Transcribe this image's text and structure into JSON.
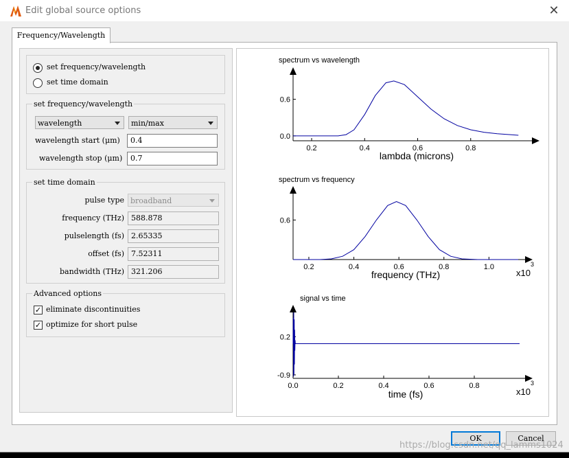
{
  "window": {
    "title": "Edit global source options",
    "close_glyph": "✕",
    "app_icon": "lumerical-logo-icon"
  },
  "tabs": [
    {
      "label": "Frequency/Wavelength",
      "active": true
    }
  ],
  "mode": {
    "options": [
      {
        "label": "set frequency/wavelength",
        "selected": true
      },
      {
        "label": "set time domain",
        "selected": false
      }
    ]
  },
  "freq_wl": {
    "title": "set frequency/wavelength",
    "type_select": "wavelength",
    "range_select": "min/max",
    "start_label": "wavelength start (μm)",
    "start_value": "0.4",
    "stop_label": "wavelength stop (μm)",
    "stop_value": "0.7"
  },
  "time_domain": {
    "title": "set time domain",
    "pulse_type_label": "pulse type",
    "pulse_type_value": "broadband",
    "frequency_label": "frequency (THz)",
    "frequency_value": "588.878",
    "pulselength_label": "pulselength (fs)",
    "pulselength_value": "2.65335",
    "offset_label": "offset (fs)",
    "offset_value": "7.52311",
    "bandwidth_label": "bandwidth (THz)",
    "bandwidth_value": "321.206"
  },
  "advanced": {
    "title": "Advanced options",
    "options": [
      {
        "label": "eliminate discontinuities",
        "checked": true
      },
      {
        "label": "optimize for short pulse",
        "checked": true
      }
    ]
  },
  "buttons": {
    "ok": "OK",
    "cancel": "Cancel"
  },
  "watermark": "https://blog.csdn.net/qq_lamms1024",
  "colors": {
    "curve": "#0000a0",
    "accent": "#0078d7"
  },
  "chart_data": [
    {
      "type": "line",
      "title": "spectrum vs wavelength",
      "xlabel": "lambda (microns)",
      "ylabel": "",
      "x_ticks": [
        "0.2",
        "0.4",
        "0.6",
        "0.8"
      ],
      "y_ticks": [
        "0.0",
        "0.6"
      ],
      "xlim": [
        0.13,
        1.0
      ],
      "ylim": [
        -0.08,
        1.0
      ],
      "series": [
        {
          "x": [
            0.13,
            0.3,
            0.33,
            0.36,
            0.4,
            0.44,
            0.48,
            0.51,
            0.55,
            0.6,
            0.65,
            0.7,
            0.75,
            0.8,
            0.85,
            0.9,
            0.95,
            0.98
          ],
          "y": [
            0.0,
            0.0,
            0.02,
            0.1,
            0.35,
            0.66,
            0.87,
            0.9,
            0.84,
            0.64,
            0.44,
            0.28,
            0.17,
            0.1,
            0.06,
            0.035,
            0.02,
            0.01
          ]
        }
      ]
    },
    {
      "type": "line",
      "title": "spectrum vs frequency",
      "xlabel": "frequency (THz)",
      "ylabel": "",
      "x_ticks": [
        "0.2",
        "0.4",
        "0.6",
        "0.8",
        "1.0"
      ],
      "y_ticks": [
        "0.6"
      ],
      "x_multiplier": "x10",
      "x_multiplier_exp": "3",
      "xlim": [
        0.13,
        1.13
      ],
      "ylim": [
        0.0,
        1.0
      ],
      "series": [
        {
          "x": [
            0.13,
            0.25,
            0.3,
            0.35,
            0.4,
            0.45,
            0.5,
            0.55,
            0.589,
            0.63,
            0.68,
            0.73,
            0.78,
            0.83,
            0.88,
            0.95,
            1.05,
            1.13
          ],
          "y": [
            0.0,
            0.0,
            0.01,
            0.05,
            0.15,
            0.35,
            0.6,
            0.82,
            0.88,
            0.82,
            0.6,
            0.35,
            0.15,
            0.05,
            0.01,
            0.0,
            0.0,
            0.0
          ]
        }
      ]
    },
    {
      "type": "line",
      "title": "signal vs time",
      "xlabel": "time (fs)",
      "ylabel": "",
      "x_ticks": [
        "0.0",
        "0.2",
        "0.4",
        "0.6",
        "0.8"
      ],
      "y_ticks": [
        "0.2",
        "-0.9"
      ],
      "x_multiplier": "x10",
      "x_multiplier_exp": "3",
      "xlim": [
        0.0,
        1.0
      ],
      "ylim": [
        -1.0,
        0.9
      ],
      "series": [
        {
          "x": [
            0.0,
            0.001,
            0.002,
            0.003,
            0.004,
            0.005,
            0.006,
            0.007,
            0.008,
            0.009,
            0.01,
            0.015,
            1.0
          ],
          "y": [
            0.0,
            0.75,
            -0.95,
            0.9,
            -0.9,
            0.7,
            -0.6,
            0.4,
            -0.2,
            0.1,
            0.0,
            0.0,
            0.0
          ]
        }
      ]
    }
  ]
}
